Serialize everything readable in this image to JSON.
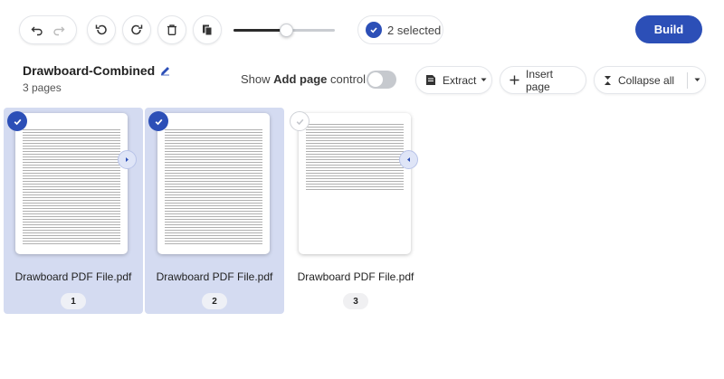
{
  "toolbar": {
    "undo_icon": "undo-icon",
    "redo_icon": "redo-icon",
    "rotate_left_icon": "rotate-left-icon",
    "rotate_right_icon": "rotate-right-icon",
    "delete_icon": "trash-icon",
    "copy_icon": "copy-pages-icon",
    "zoom_level": 0.52,
    "selected_count": "2",
    "selected_label": "selected",
    "build_label": "Build"
  },
  "document": {
    "title": "Drawboard-Combined",
    "page_count_label": "3 pages"
  },
  "controls": {
    "show_prefix": "Show",
    "show_bold": "Add page",
    "show_suffix": "control",
    "toggle_on": false,
    "extract_label": "Extract",
    "insert_label": "Insert page",
    "collapse_label": "Collapse all"
  },
  "pages": [
    {
      "filename": "Drawboard PDF File.pdf",
      "number": "1",
      "selected": true
    },
    {
      "filename": "Drawboard PDF File.pdf",
      "number": "2",
      "selected": true
    },
    {
      "filename": "Drawboard PDF File.pdf",
      "number": "3",
      "selected": false
    }
  ],
  "colors": {
    "accent": "#2c4fb7",
    "selected_card": "#d4dbf1"
  }
}
